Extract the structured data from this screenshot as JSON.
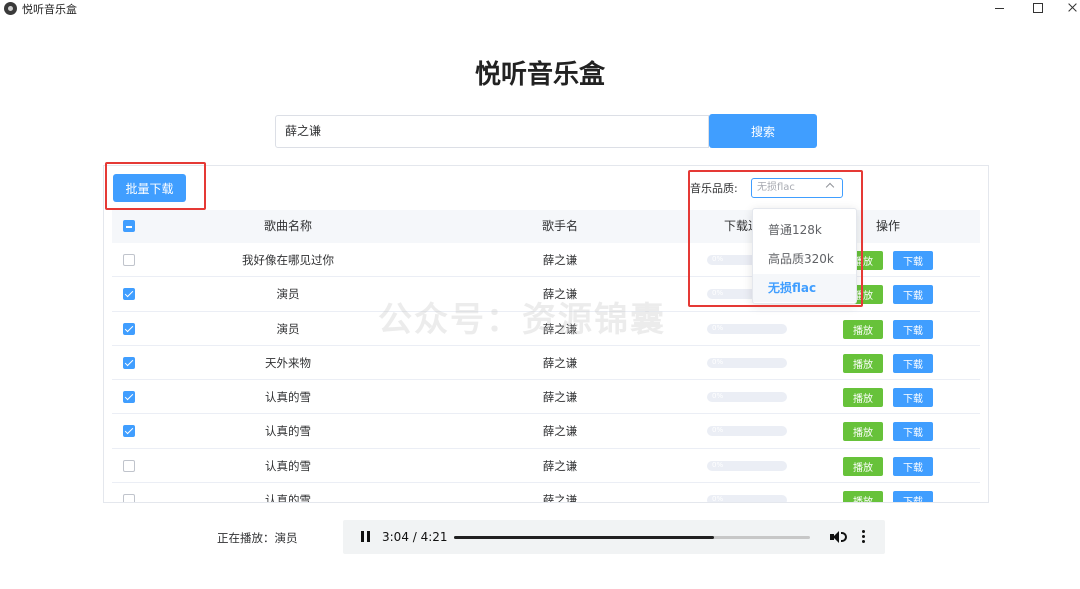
{
  "window": {
    "title": "悦听音乐盒",
    "minimize_icon": "minimize-icon",
    "maximize_icon": "maximize-icon",
    "close_icon": "close-icon"
  },
  "page_title": "悦听音乐盒",
  "search": {
    "value": "薛之谦",
    "button_label": "搜索"
  },
  "toolbar": {
    "batch_download_label": "批量下载",
    "quality_label": "音乐品质:",
    "quality_selected": "无损flac"
  },
  "quality_dropdown": {
    "options": [
      "普通128k",
      "高品质320k",
      "无损flac"
    ],
    "selected_index": 2
  },
  "table": {
    "headers": {
      "song": "歌曲名称",
      "artist": "歌手名",
      "progress": "下载进",
      "actions": "操作"
    },
    "select_all_state": "indeterminate",
    "play_label": "播放",
    "download_label": "下载",
    "rows": [
      {
        "song": "我好像在哪见过你",
        "artist": "薛之谦",
        "checked": false,
        "progress": "0%"
      },
      {
        "song": "演员",
        "artist": "薛之谦",
        "checked": true,
        "progress": "0%"
      },
      {
        "song": "演员",
        "artist": "薛之谦",
        "checked": true,
        "progress": "0%"
      },
      {
        "song": "天外来物",
        "artist": "薛之谦",
        "checked": true,
        "progress": "0%"
      },
      {
        "song": "认真的雪",
        "artist": "薛之谦",
        "checked": true,
        "progress": "0%"
      },
      {
        "song": "认真的雪",
        "artist": "薛之谦",
        "checked": true,
        "progress": "0%"
      },
      {
        "song": "认真的雪",
        "artist": "薛之谦",
        "checked": false,
        "progress": "0%"
      },
      {
        "song": "认真的雪",
        "artist": "薛之谦",
        "checked": false,
        "progress": "0%"
      }
    ]
  },
  "watermark": "公众号：资源锦囊",
  "player": {
    "now_playing": "正在播放：演员",
    "time": "3:04 / 4:21",
    "progress_fraction": 0.73,
    "colors": {
      "accent": "#409eff",
      "play": "#67c23a",
      "highlight": "#e53935"
    }
  }
}
